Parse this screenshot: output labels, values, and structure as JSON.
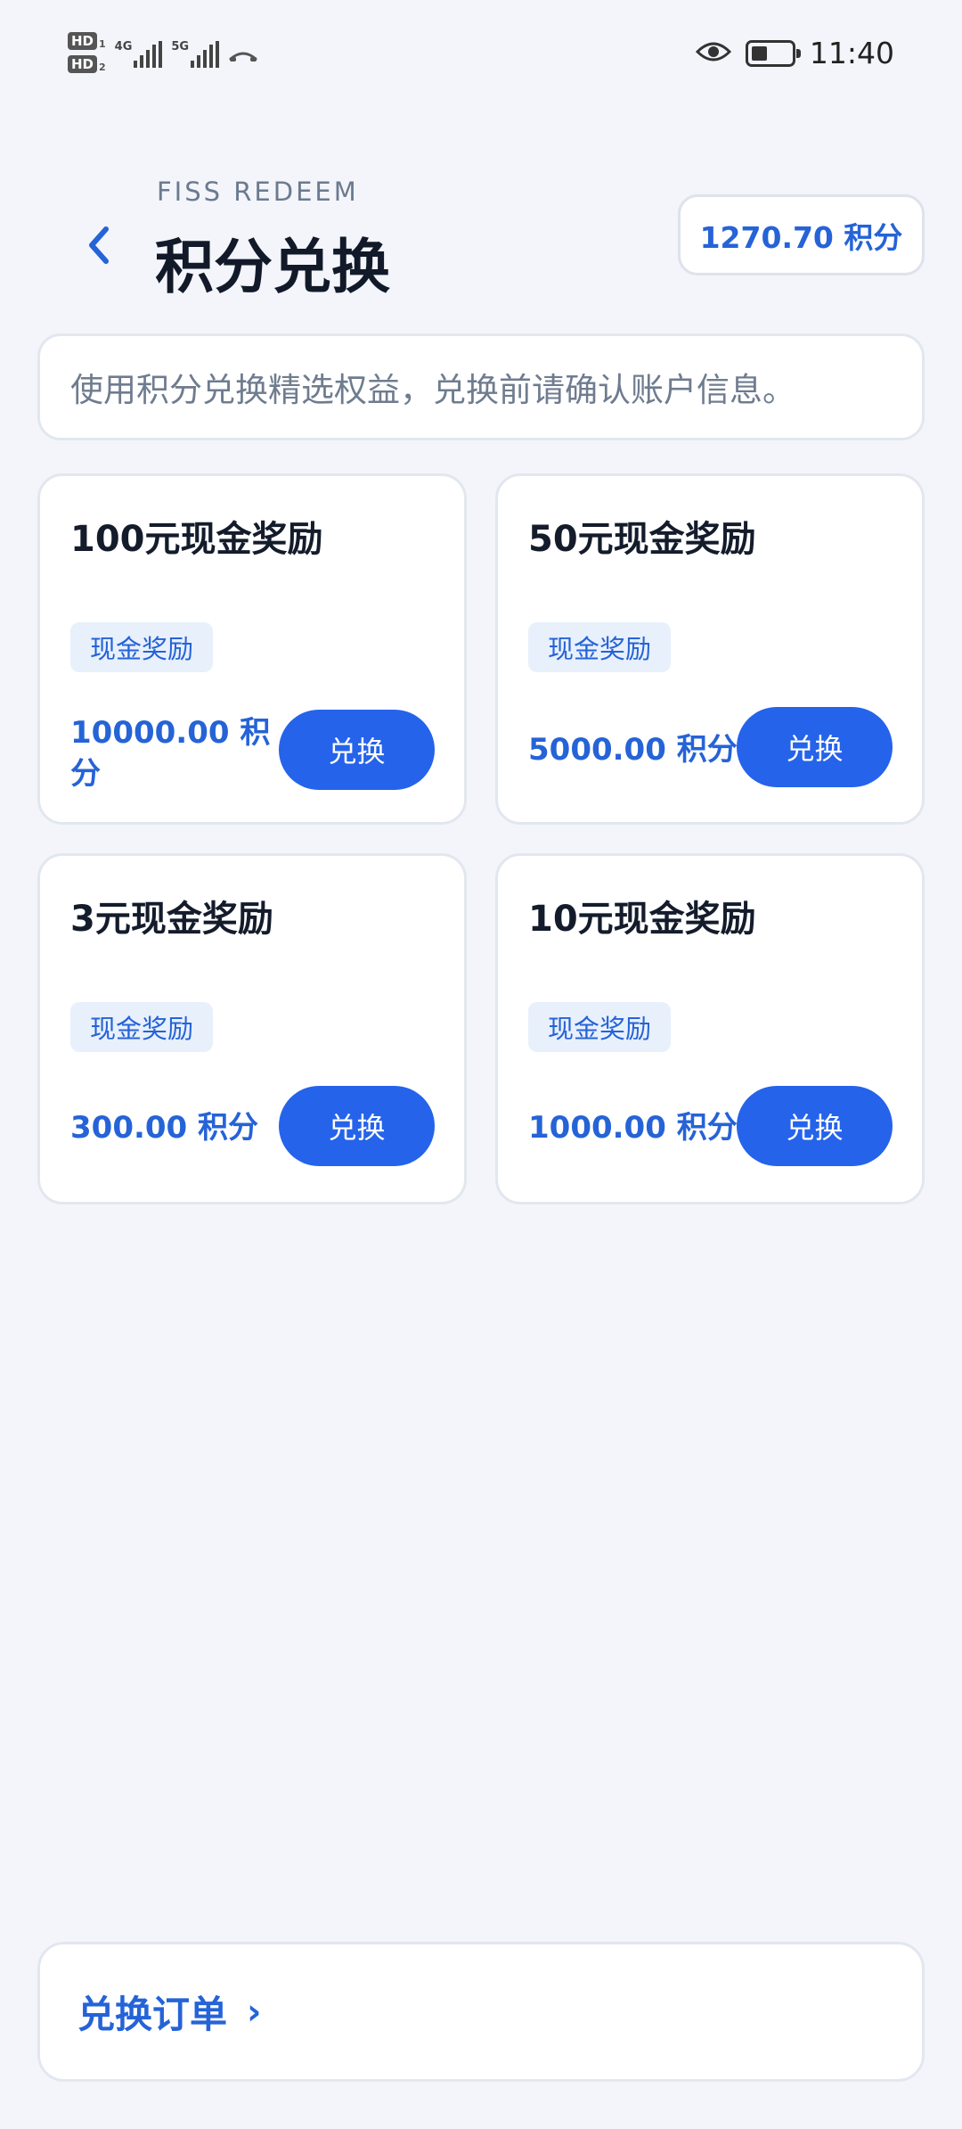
{
  "status_bar": {
    "sim1": {
      "label": "HD",
      "index": "1"
    },
    "sim2": {
      "label": "HD",
      "index": "2"
    },
    "net1": "4G",
    "net2": "5G",
    "time": "11:40",
    "battery_level": 0.4,
    "icons": [
      "signal-icon",
      "call-icon",
      "eye-icon",
      "battery-icon"
    ]
  },
  "header": {
    "subtitle": "FISS REDEEM",
    "title": "积分兑换",
    "points_balance": "1270.70 积分",
    "back_icon": "chevron-left-icon"
  },
  "notice": "使用积分兑换精选权益，兑换前请确认账户信息。",
  "rewards": [
    {
      "title": "100元现金奖励",
      "tag": "现金奖励",
      "price": "10000.00 积分",
      "button": "兑换"
    },
    {
      "title": "50元现金奖励",
      "tag": "现金奖励",
      "price": "5000.00 积分",
      "button": "兑换"
    },
    {
      "title": "3元现金奖励",
      "tag": "现金奖励",
      "price": "300.00 积分",
      "button": "兑换"
    },
    {
      "title": "10元现金奖励",
      "tag": "现金奖励",
      "price": "1000.00 积分",
      "button": "兑换"
    }
  ],
  "footer": {
    "orders_label": "兑换订单",
    "chevron": "›"
  },
  "colors": {
    "accent": "#2563eb",
    "accent_text": "#2563d7",
    "background": "#f3f5fa",
    "tag_background": "#e8f0fc"
  }
}
